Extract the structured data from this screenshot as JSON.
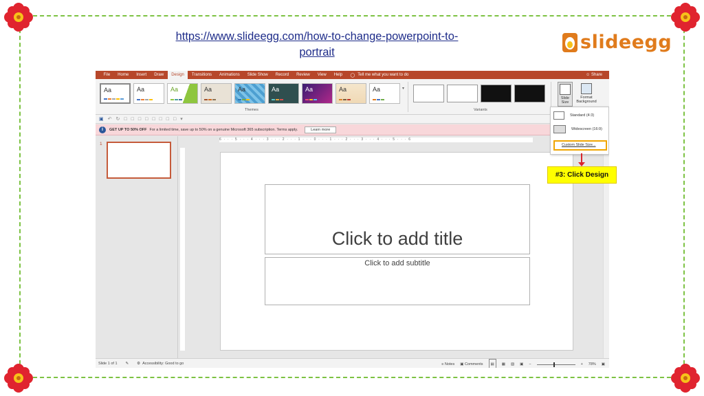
{
  "header": {
    "url_text": "https://www.slideegg.com/how-to-change-powerpoint-to-portrait",
    "brand": "slideegg"
  },
  "colors": {
    "frame": "#7cc242",
    "ppt_accent": "#b7472a",
    "callout_bg": "#ffff00",
    "highlight": "#f0a500"
  },
  "menu": {
    "items": [
      "File",
      "Home",
      "Insert",
      "Draw",
      "Design",
      "Transitions",
      "Animations",
      "Slide Show",
      "Record",
      "Review",
      "View",
      "Help"
    ],
    "active": "Design",
    "tell_me": "Tell me what you want to do",
    "share": "Share"
  },
  "ribbon": {
    "theme_sample": "Aa",
    "themes_label": "Themes",
    "variants_label": "Variants",
    "slide_size_label": "Slide Size",
    "format_bg_label": "Format Background"
  },
  "infobar": {
    "bold": "GET UP TO 50% OFF",
    "text": "For a limited time, save up to 50% on a genuine Microsoft 365 subscription. Terms apply.",
    "button": "Learn more"
  },
  "thumbs": {
    "number": "1"
  },
  "ruler": {
    "text": "6 · · · 5 · · · 4 · · · 3 · · · 2 · · · 1 · · · 0 · · · 1 · · · 2 · · · 3 · · · 4 · · · 5 · · · 6"
  },
  "slide": {
    "title_placeholder": "Click to add title",
    "subtitle_placeholder": "Click to add subtitle"
  },
  "dropdown": {
    "standard": "Standard (4:3)",
    "widescreen": "Widescreen (16:9)",
    "custom": "Custom Slide Size..."
  },
  "status": {
    "slide_count": "Slide 1 of 1",
    "accessibility": "Accessibility: Good to go",
    "notes": "Notes",
    "comments": "Comments",
    "zoom": "78%"
  },
  "callout": {
    "text": "#3: Click Design"
  }
}
